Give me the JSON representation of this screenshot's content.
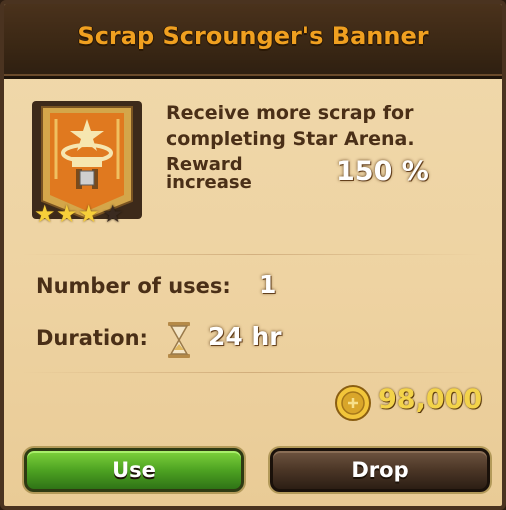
{
  "header": {
    "title": "Scrap Scrounger's Banner"
  },
  "item": {
    "icon": "banner-icon",
    "stars_filled": 3,
    "stars_total": 4,
    "description": "Receive more scrap for completing Star Arena.",
    "reward_label_line1": "Reward",
    "reward_label_line2": "increase",
    "reward_value": "150 %"
  },
  "uses": {
    "label": "Number of uses:",
    "value": "1"
  },
  "duration": {
    "label": "Duration:",
    "icon": "hourglass-icon",
    "value": "24 hr"
  },
  "price": {
    "icon": "coin-icon",
    "value": "98,000"
  },
  "buttons": {
    "use_label": "Use",
    "drop_label": "Drop"
  },
  "colors": {
    "title": "#f0a020",
    "header_bg": "#3a2714",
    "panel_bg": "#eed3a2",
    "text_brown": "#4a2f17",
    "use_button": "#4ea322",
    "drop_button": "#4b3626",
    "price_gold": "#f3d34a"
  }
}
